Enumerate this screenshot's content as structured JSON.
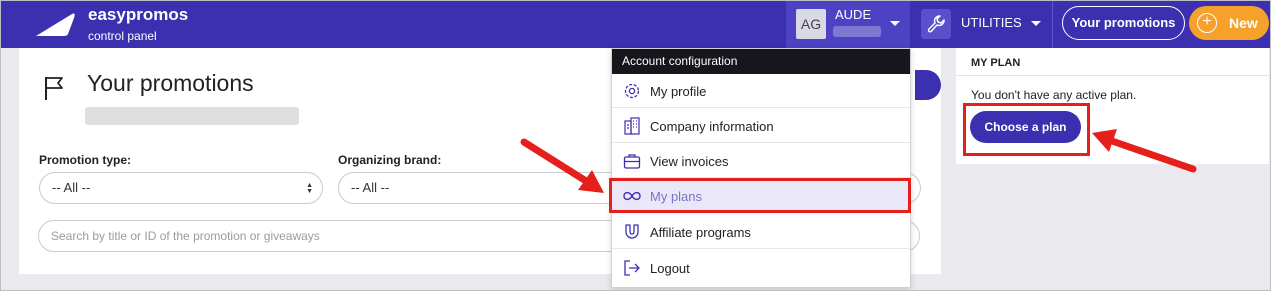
{
  "header": {
    "brand_name": "easypromos",
    "brand_subtitle": "control panel",
    "account_initials": "AG",
    "account_name": "AUDE",
    "utilities_label": "UTILITIES",
    "your_promotions_button": "Your promotions",
    "new_button": "New"
  },
  "main": {
    "page_title": "Your promotions",
    "promotion_type_label": "Promotion type:",
    "promotion_type_value": "-- All --",
    "organizing_brand_label": "Organizing brand:",
    "organizing_brand_value": "-- All --",
    "search_placeholder": "Search by title or ID of the promotion or giveaways"
  },
  "dropdown": {
    "header": "Account configuration",
    "items": [
      {
        "label": "My profile",
        "icon": "gear-icon"
      },
      {
        "label": "Company information",
        "icon": "building-icon"
      },
      {
        "label": "View invoices",
        "icon": "briefcase-icon"
      },
      {
        "label": "My plans",
        "icon": "infinity-icon",
        "active": true
      },
      {
        "label": "Affiliate programs",
        "icon": "magnet-icon"
      },
      {
        "label": "Logout",
        "icon": "logout-icon"
      }
    ]
  },
  "plan_panel": {
    "title": "MY PLAN",
    "message": "You don't have any active plan.",
    "choose_button": "Choose a plan"
  },
  "colors": {
    "brand": "#3c2fb0",
    "accent_orange": "#f6a12a",
    "annotation_red": "#e5201c"
  }
}
